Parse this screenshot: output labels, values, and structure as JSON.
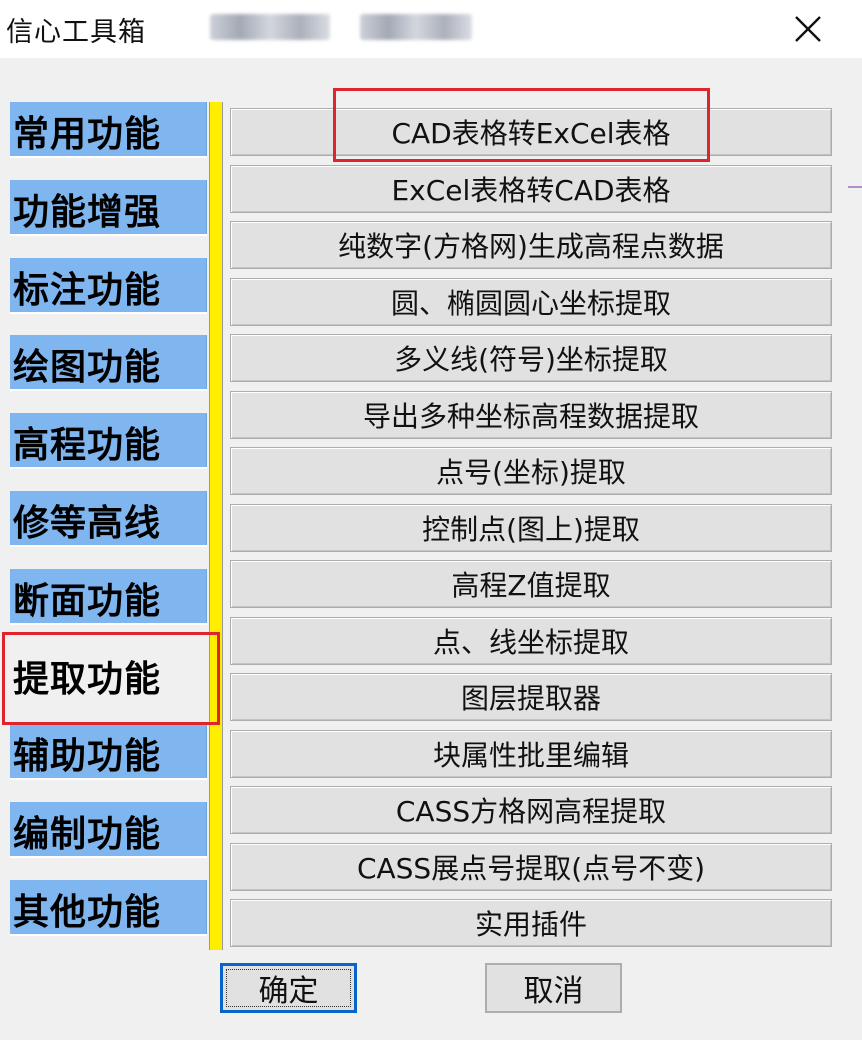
{
  "window": {
    "title": "信心工具箱",
    "close_icon": "close-icon"
  },
  "sidebar": {
    "active_index": 7,
    "items": [
      {
        "label": "常用功能"
      },
      {
        "label": "功能增强"
      },
      {
        "label": "标注功能"
      },
      {
        "label": "绘图功能"
      },
      {
        "label": "高程功能"
      },
      {
        "label": "修等高线"
      },
      {
        "label": "断面功能"
      },
      {
        "label": "提取功能"
      },
      {
        "label": "辅助功能"
      },
      {
        "label": "编制功能"
      },
      {
        "label": "其他功能"
      }
    ]
  },
  "functions": [
    {
      "label": "CAD表格转ExCel表格"
    },
    {
      "label": "ExCel表格转CAD表格"
    },
    {
      "label": "纯数字(方格网)生成高程点数据"
    },
    {
      "label": "圆、椭圆圆心坐标提取"
    },
    {
      "label": "多义线(符号)坐标提取"
    },
    {
      "label": "导出多种坐标高程数据提取"
    },
    {
      "label": "点号(坐标)提取"
    },
    {
      "label": "控制点(图上)提取"
    },
    {
      "label": "高程Z值提取"
    },
    {
      "label": "点、线坐标提取"
    },
    {
      "label": "图层提取器"
    },
    {
      "label": "块属性批里编辑"
    },
    {
      "label": "CASS方格网高程提取"
    },
    {
      "label": "CASS展点号提取(点号不变)"
    },
    {
      "label": "实用插件"
    }
  ],
  "footer": {
    "ok_label": "确定",
    "cancel_label": "取消"
  },
  "colors": {
    "tab_blue": "#7fb6f0",
    "divider_yellow": "#ffee00",
    "highlight_red": "#e0242e",
    "default_button_border": "#0a64c8"
  }
}
